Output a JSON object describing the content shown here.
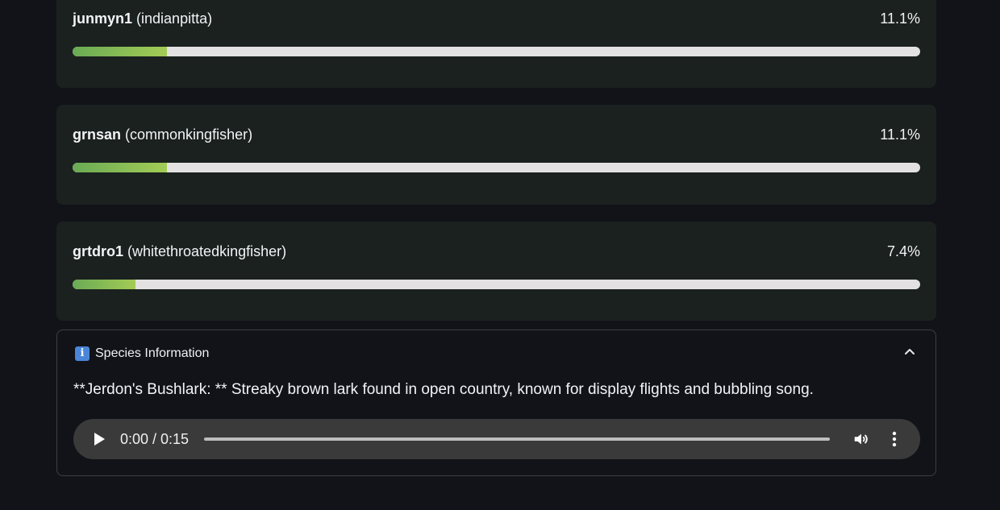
{
  "predictions": [
    {
      "code": "junmyn1",
      "name": "(indianpitta)",
      "percent": "11.1%",
      "fill_fraction": 0.111
    },
    {
      "code": "grnsan",
      "name": "(commonkingfisher)",
      "percent": "11.1%",
      "fill_fraction": 0.111
    },
    {
      "code": "grtdro1",
      "name": "(whitethroatedkingfisher)",
      "percent": "7.4%",
      "fill_fraction": 0.074
    }
  ],
  "expander": {
    "icon": "info-icon",
    "title": "Species Information",
    "description": "**Jerdon's Bushlark: ** Streaky brown lark found in open country, known for display flights and bubbling song."
  },
  "audio": {
    "time": "0:00 / 0:15",
    "progress_fraction": 0
  },
  "colors": {
    "background": "#111318",
    "card": "#1b211f",
    "bar_start": "#6aaa55",
    "bar_end": "#a3cc55",
    "track": "#e3e1e1",
    "info_accent": "#4a86d8"
  }
}
